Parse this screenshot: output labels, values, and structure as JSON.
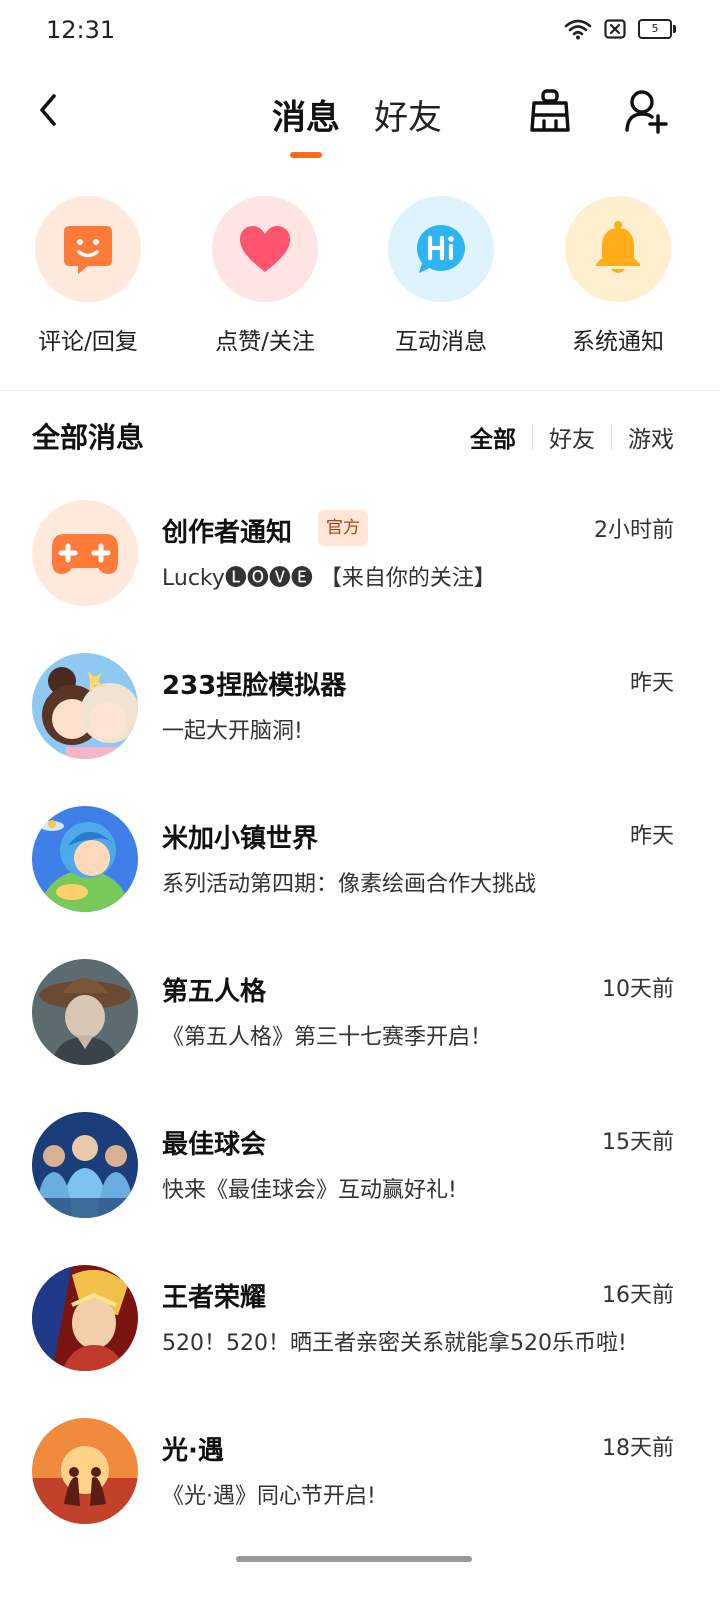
{
  "status_bar": {
    "time": "12:31",
    "battery": "5",
    "icons": [
      "wifi-icon",
      "sim-x-icon",
      "battery-icon"
    ]
  },
  "top_nav": {
    "tabs": [
      {
        "label": "消息",
        "active": true
      },
      {
        "label": "好友",
        "active": false
      }
    ],
    "accent": "#ff6a1a",
    "icons": [
      "back-icon",
      "clean-basket-icon",
      "add-friend-icon"
    ]
  },
  "shortcuts": [
    {
      "label": "评论/回复",
      "icon": "comment-smile-icon",
      "bg": "#ffe9dc",
      "color": "#ff7b3a"
    },
    {
      "label": "点赞/关注",
      "icon": "heart-icon",
      "bg": "#ffe4e4",
      "color": "#ff5470"
    },
    {
      "label": "互动消息",
      "icon": "hi-bubble-icon",
      "bg": "#dff3fd",
      "color": "#2cb5f2"
    },
    {
      "label": "系统通知",
      "icon": "bell-icon",
      "bg": "#ffefcf",
      "color": "#ffad1a"
    }
  ],
  "section": {
    "title": "全部消息",
    "filters": [
      {
        "label": "全部",
        "active": true
      },
      {
        "label": "好友",
        "active": false
      },
      {
        "label": "游戏",
        "active": false
      }
    ]
  },
  "messages": [
    {
      "title": "创作者通知",
      "badge": "官方",
      "time": "2小时前",
      "preview": "Lucky🅛🅞🅥🅔 【来自你的关注】",
      "avatar": "gamepad-icon"
    },
    {
      "title": "233捏脸模拟器",
      "time": "昨天",
      "preview": "一起大开脑洞!",
      "avatar": "anime-girls-avatar"
    },
    {
      "title": "米加小镇世界",
      "time": "昨天",
      "preview": "系列活动第四期：像素绘画合作大挑战",
      "avatar": "cartoon-kid-avatar"
    },
    {
      "title": "第五人格",
      "time": "10天前",
      "preview": "《第五人格》第三十七赛季开启！",
      "avatar": "hat-character-avatar"
    },
    {
      "title": "最佳球会",
      "time": "15天前",
      "preview": "快来《最佳球会》互动赢好礼!",
      "avatar": "football-players-avatar"
    },
    {
      "title": "王者荣耀",
      "time": "16天前",
      "preview": "520！520！晒王者亲密关系就能拿520乐币啦!",
      "avatar": "hero-warrior-avatar"
    },
    {
      "title": "光·遇",
      "time": "18天前",
      "preview": "《光·遇》同心节开启!",
      "avatar": "sunset-couple-avatar"
    }
  ]
}
